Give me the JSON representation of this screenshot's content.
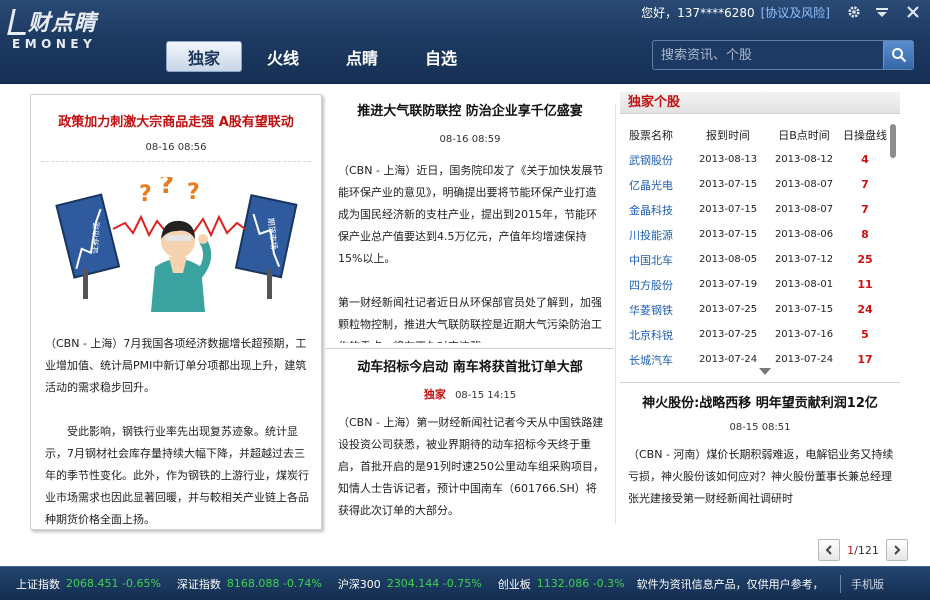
{
  "header": {
    "logo_text": "财点睛",
    "logo_sub": "EMONEY",
    "greeting": "您好，137****6280",
    "protocol_link": "[协议及风险]",
    "tabs": [
      {
        "label": "独家",
        "active": true
      },
      {
        "label": "火线",
        "active": false
      },
      {
        "label": "点睛",
        "active": false
      },
      {
        "label": "自选",
        "active": false
      }
    ],
    "search_placeholder": "搜索资讯、个股"
  },
  "card1": {
    "title": "政策加力刺激大宗商品走强  A股有望联动",
    "time": "08-16  08:56",
    "paragraphs": [
      "（CBN - 上海）7月我国各项经济数据增长超预期，工业增加值、统计局PMI中新订单分项都出现上升，建筑活动的需求稳步回升。",
      "受此影响，钢铁行业率先出现复苏迹象。统计显示，7月钢材社会库存量持续大幅下降，并超越过去三年的季节性变化。此外，作为钢铁的上游行业，煤炭行业市场需求也因此显著回暖，并与較相关产业链上各品种期货价格全面上扬。"
    ],
    "illustration_labels": [
      "证券市场",
      "期货市场"
    ]
  },
  "article2": {
    "title": "推进大气联防联控  防治企业享千亿盛宴",
    "time": "08-16  08:59",
    "paragraphs": [
      "（CBN - 上海）近日，国务院印发了《关于加快发展节能环保产业的意见》，明确提出要将节能环保产业打造成为国民经济新的支柱产业，提出到2015年，节能环保产业总产值要达到4.5万亿元，产值年均增速保持15%以上。",
      "第一财经新闻社记者近日从环保部官员处了解到，加强颗粒物控制，推进大气联防联控是近期大气污染防治工作的重点，将在不久对京津冀、"
    ]
  },
  "article3": {
    "title": "动车招标今启动  南车将获首批订单大部",
    "tag": "独家",
    "time": "08-15  14:15",
    "body": "（CBN - 上海）第一财经新闻社记者今天从中国铁路建设投资公司获悉，被业界期待的动车招标今天终于重启，首批开启的是91列时速250公里动车组采购项目，知情人士告诉记者，预计中国南车（601766.SH）将获得此次订单的大部分。"
  },
  "stocks": {
    "section_title": "独家个股",
    "headers": [
      "股票名称",
      "报到时间",
      "日B点时间",
      "日操盘线"
    ],
    "rows": [
      {
        "name": "武钢股份",
        "report": "2013-08-13",
        "bpoint": "2013-08-12",
        "days": "4"
      },
      {
        "name": "亿晶光电",
        "report": "2013-07-15",
        "bpoint": "2013-08-07",
        "days": "7"
      },
      {
        "name": "金晶科技",
        "report": "2013-07-15",
        "bpoint": "2013-08-07",
        "days": "7"
      },
      {
        "name": "川投能源",
        "report": "2013-07-15",
        "bpoint": "2013-08-06",
        "days": "8"
      },
      {
        "name": "中国北车",
        "report": "2013-08-05",
        "bpoint": "2013-07-12",
        "days": "25"
      },
      {
        "name": "四方股份",
        "report": "2013-07-19",
        "bpoint": "2013-08-01",
        "days": "11"
      },
      {
        "name": "华菱钢铁",
        "report": "2013-07-25",
        "bpoint": "2013-07-15",
        "days": "24"
      },
      {
        "name": "北京科锐",
        "report": "2013-07-25",
        "bpoint": "2013-07-16",
        "days": "5"
      },
      {
        "name": "长城汽车",
        "report": "2013-07-24",
        "bpoint": "2013-07-24",
        "days": "17"
      }
    ]
  },
  "article4": {
    "title": "神火股份:战略西移  明年望贡献利润12亿",
    "time": "08-15  08:51",
    "body": "（CBN - 河南）煤价长期积弱难返，电解铝业务又持续亏损，神火股份该如何应对？神火股份董事长兼总经理张光建接受第一财经新闻社调研时"
  },
  "pager": {
    "current": "1",
    "total": "/121"
  },
  "ticker": {
    "items": [
      {
        "name": "上证指数",
        "value": "2068.451 -0.65%"
      },
      {
        "name": "深证指数",
        "value": "8168.088 -0.74%"
      },
      {
        "name": "沪深300",
        "value": "2304.144 -0.75%"
      },
      {
        "name": "创业板",
        "value": "1132.086 -0.3%"
      }
    ],
    "notice": "软件为资讯信息产品，仅供用户参考，",
    "mobile": "手机版"
  },
  "colors": {
    "accent_red": "#c01010",
    "link_blue": "#1d5fae",
    "ticker_green": "#3fd34f",
    "header_navy": "#1d3a62"
  }
}
